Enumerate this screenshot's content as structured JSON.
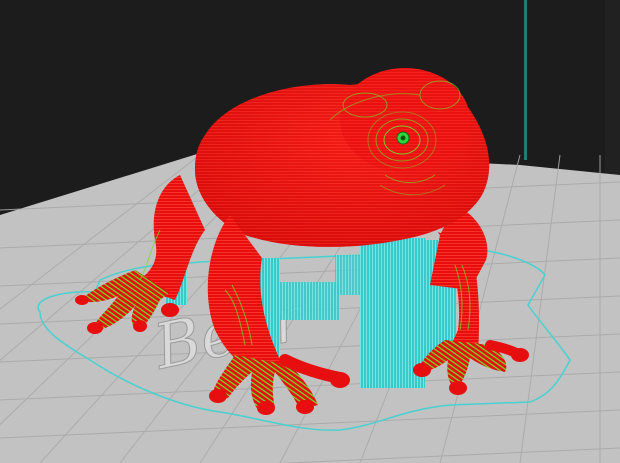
{
  "viewport": {
    "background_color": "#1c1c1c",
    "bed_color": "#c2c2c2",
    "bed_grid_color": "#a9a9a9",
    "bed_logo_text": "Bear",
    "colors": {
      "perimeter": "#ff1a1a",
      "infill_highlight": "#6fdc2a",
      "support": "#3fd7d7",
      "skirt": "#49d0d0",
      "frame": "#2fc7c7",
      "eye": "#2fd63f"
    }
  }
}
